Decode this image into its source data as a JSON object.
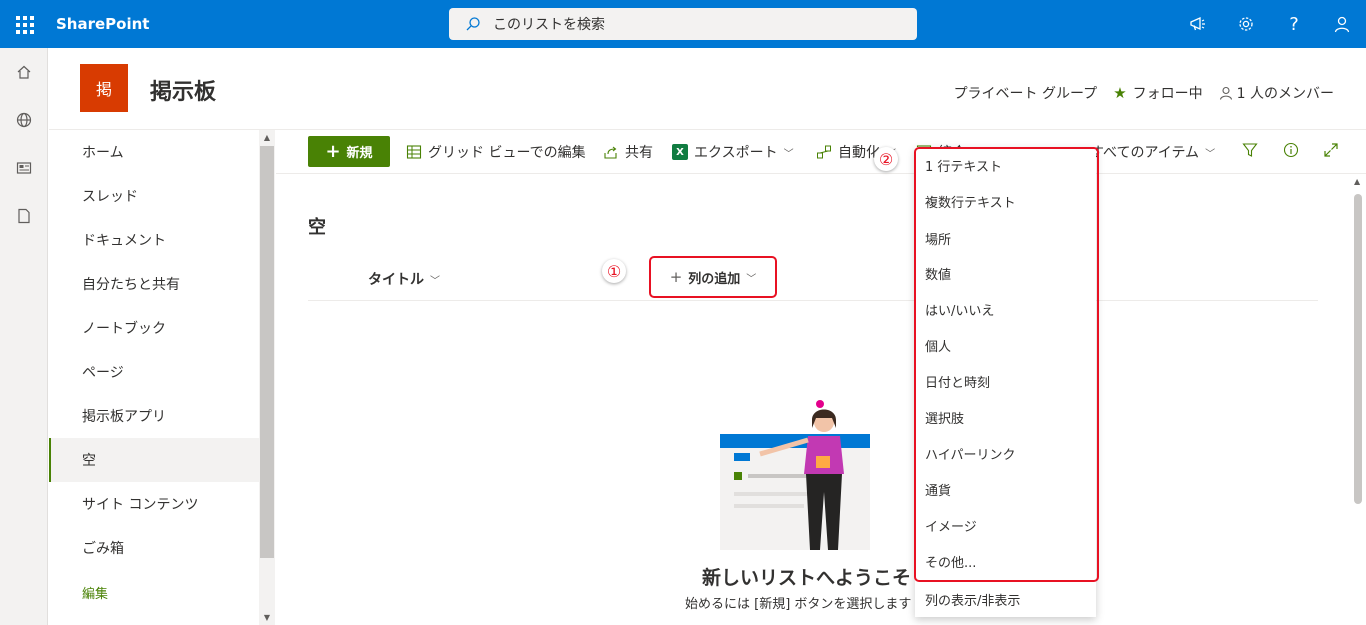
{
  "suitebar": {
    "brand": "SharePoint",
    "search_placeholder": "このリストを検索"
  },
  "site": {
    "logo_char": "掲",
    "title": "掲示板",
    "privacy": "プライベート グループ",
    "follow": "フォロー中",
    "members": "1 人のメンバー"
  },
  "nav": {
    "items": [
      {
        "label": "ホーム"
      },
      {
        "label": "スレッド"
      },
      {
        "label": "ドキュメント"
      },
      {
        "label": "自分たちと共有"
      },
      {
        "label": "ノートブック"
      },
      {
        "label": "ページ"
      },
      {
        "label": "掲示板アプリ"
      },
      {
        "label": "空"
      },
      {
        "label": "サイト コンテンツ"
      },
      {
        "label": "ごみ箱"
      }
    ],
    "selected_index": 7,
    "edit_label": "編集"
  },
  "commandbar": {
    "new": "新規",
    "grid_edit": "グリッド ビューでの編集",
    "share": "共有",
    "export": "エクスポート",
    "automate": "自動化",
    "integrate": "統合",
    "view": "すべてのアイテム"
  },
  "list": {
    "title": "空",
    "column_title": "タイトル",
    "add_column": "列の追加",
    "welcome_title": "新しいリストへようこそ",
    "welcome_sub": "始めるには [新規] ボタンを選択します"
  },
  "callouts": {
    "one": "①",
    "two": "②"
  },
  "menu": {
    "items": [
      "1 行テキスト",
      "複数行テキスト",
      "場所",
      "数値",
      "はい/いいえ",
      "個人",
      "日付と時刻",
      "選択肢",
      "ハイパーリンク",
      "通貨",
      "イメージ",
      "その他..."
    ],
    "show_hide": "列の表示/非表示"
  },
  "colors": {
    "suitebar": "#0078d4",
    "accent": "#498205",
    "logo": "#d83b01",
    "highlight": "#e81123"
  }
}
